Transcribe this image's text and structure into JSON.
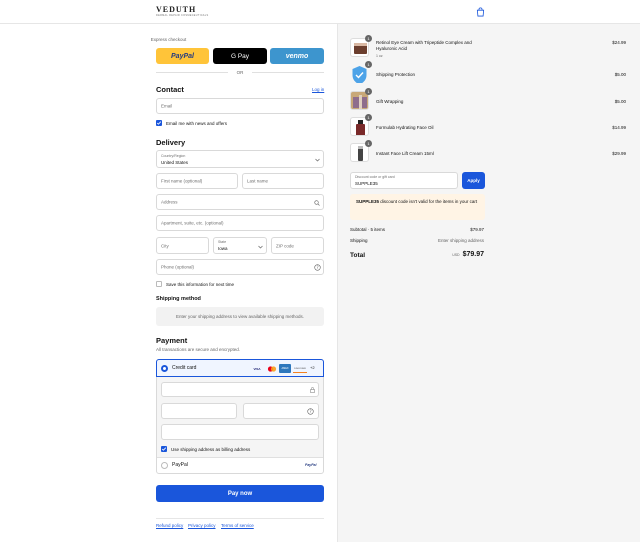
{
  "header": {
    "logo_text": "VEDUTH",
    "logo_sub": "DERMAL REPAIR COSMECEUTICALS"
  },
  "express": {
    "label": "Express checkout",
    "paypal": "PayPal",
    "gpay": "G Pay",
    "venmo": "venmo",
    "or": "OR"
  },
  "contact": {
    "title": "Contact",
    "login": "Log in",
    "email_placeholder": "Email",
    "news_label": "Email me with news and offers",
    "news_checked": true
  },
  "delivery": {
    "title": "Delivery",
    "country_label": "Country/Region",
    "country_value": "United States",
    "first_name": "First name (optional)",
    "last_name": "Last name",
    "address": "Address",
    "apartment": "Apartment, suite, etc. (optional)",
    "city": "City",
    "state_label": "State",
    "state_value": "Iowa",
    "zip": "ZIP code",
    "phone": "Phone (optional)",
    "save_label": "Save this information for next time",
    "save_checked": false
  },
  "shipping_method": {
    "title": "Shipping method",
    "message": "Enter your shipping address to view available shipping methods."
  },
  "payment": {
    "title": "Payment",
    "subtitle": "All transactions are secure and encrypted.",
    "credit_card_label": "Credit card",
    "card_brands": [
      "VISA",
      "MC",
      "AMEX",
      "DISCOVER"
    ],
    "more_cards": "+2",
    "billing_label": "Use shipping address as billing address",
    "billing_checked": true,
    "paypal_option": "PayPal",
    "paypal_badge": "PayPal",
    "selected_method": "credit-card"
  },
  "pay_button": "Pay now",
  "footer_links": [
    "Refund policy",
    "Privacy policy",
    "Terms of service"
  ],
  "cart": {
    "items": [
      {
        "qty": "1",
        "name": "Retinol Eye Cream with Tripeptide Complex and Hyaluronic Acid",
        "variant": "1 oz",
        "price": "$24.99",
        "icon": "jar-thumbnail"
      },
      {
        "qty": "1",
        "name": "Shipping Protection",
        "variant": "",
        "price": "$5.00",
        "icon": "shield-check-icon"
      },
      {
        "qty": "1",
        "name": "Gift Wrapping",
        "variant": "",
        "price": "$5.00",
        "icon": "gift-thumbnail"
      },
      {
        "qty": "1",
        "name": "Formulab Hydrating Face Oil",
        "variant": "",
        "price": "$14.99",
        "icon": "bottle-thumbnail"
      },
      {
        "qty": "1",
        "name": "Instant Face Lift Cream 15ml",
        "variant": "",
        "price": "$29.99",
        "icon": "tube-thumbnail"
      }
    ],
    "discount": {
      "label": "Discount code or gift card",
      "value": "SUPPLE35",
      "apply": "Apply"
    },
    "discount_error": {
      "code": "SUPPLE35",
      "message": " discount code isn't valid for the items in your cart"
    },
    "subtotal_label": "Subtotal · 5 items",
    "subtotal_value": "$79.97",
    "shipping_label": "Shipping",
    "shipping_value": "Enter shipping address",
    "total_label": "Total",
    "currency": "USD",
    "total_value": "$79.97"
  },
  "colors": {
    "accent": "#1a56db",
    "paypal": "#ffc439",
    "venmo": "#3d95ce",
    "error_bg": "#fff4e5"
  }
}
